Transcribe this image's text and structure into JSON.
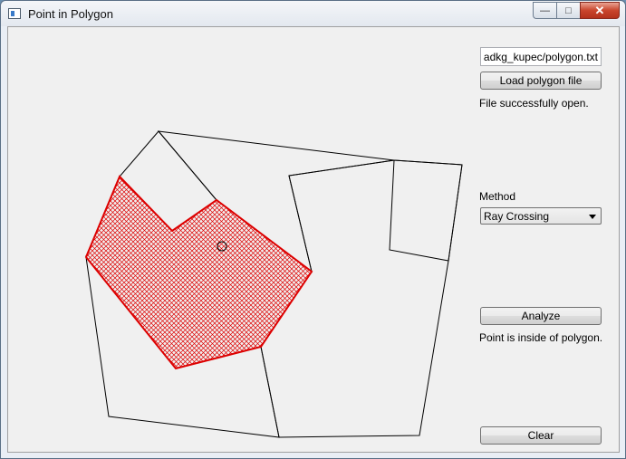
{
  "window": {
    "title": "Point in Polygon",
    "icon": "app-window-icon"
  },
  "controls": {
    "file_path": "b/adkg_kupec/polygon.txt",
    "load_button": "Load polygon file",
    "load_status": "File successfully open.",
    "method_label": "Method",
    "method_selected": "Ray Crossing",
    "analyze_button": "Analyze",
    "analyze_result": "Point is inside of polygon.",
    "clear_button": "Clear"
  },
  "colors": {
    "highlight": "#dd0000",
    "outline": "#000000",
    "panel": "#f0f0f0"
  }
}
